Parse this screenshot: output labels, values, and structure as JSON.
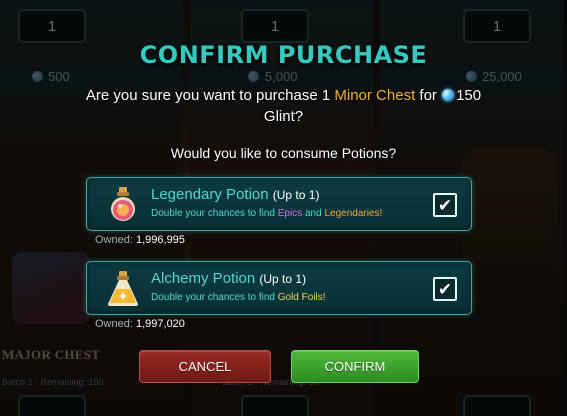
{
  "background": {
    "quantities": [
      "1",
      "1",
      "1"
    ],
    "prices": [
      "500",
      "5,000",
      "25,000"
    ],
    "section_label": "MAJOR CHEST",
    "batch_left": "Batch 1 - Remaining: 150",
    "batch_mid": "Batch 1 - Remaining: 30"
  },
  "dialog": {
    "title": "CONFIRM PURCHASE",
    "question_prefix": "Are you sure you want to purchase 1 ",
    "item_name": "Minor Chest",
    "question_for": " for ",
    "price": "150",
    "currency": "Glint?",
    "consume_prompt": "Would you like to consume Potions?"
  },
  "potions": [
    {
      "name": "Legendary Potion",
      "limit": "(Up to 1)",
      "desc_prefix": "Double your chances to find ",
      "desc_hl1": "Epics",
      "desc_mid": " and ",
      "desc_hl2": "Legendaries!",
      "owned_label": "Owned:",
      "owned_value": "1,996,995",
      "checked": true
    },
    {
      "name": "Alchemy Potion",
      "limit": "(Up to 1)",
      "desc_prefix": "Double your chances to find ",
      "desc_hl1": "Gold Foils!",
      "owned_label": "Owned:",
      "owned_value": "1,997,020",
      "checked": true
    }
  ],
  "buttons": {
    "cancel": "CANCEL",
    "confirm": "CONFIRM"
  },
  "checkmark": "✔",
  "colors": {
    "title": "#35c9c0",
    "item_highlight": "#f2b233",
    "epic": "#d46de8",
    "legendary": "#e9a83a",
    "gold": "#f0d35a",
    "cancel": "#8a241e",
    "confirm": "#3ea52e"
  }
}
